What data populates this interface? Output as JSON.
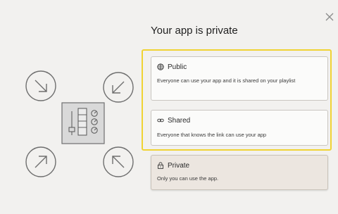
{
  "dialog": {
    "title": "Your app is private",
    "close_icon": "close-icon"
  },
  "options": [
    {
      "id": "public",
      "icon": "globe-icon",
      "label": "Public",
      "description": "Everyone can use your app and it is shared on your playlist",
      "highlighted": true
    },
    {
      "id": "shared",
      "icon": "link-icon",
      "label": "Shared",
      "description": "Everyone that knows the link can use your app",
      "highlighted": true
    },
    {
      "id": "private",
      "icon": "lock-icon",
      "label": "Private",
      "description": "Only you can use the app.",
      "selected": true
    }
  ],
  "colors": {
    "highlight": "#f0d334",
    "selected_bg": "#ece6e0",
    "background": "#f2f1ef"
  }
}
